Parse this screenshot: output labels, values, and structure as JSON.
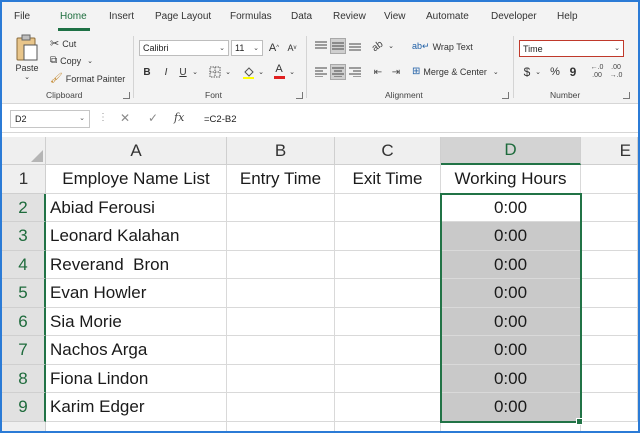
{
  "menu": {
    "items": [
      "File",
      "Home",
      "Insert",
      "Page Layout",
      "Formulas",
      "Data",
      "Review",
      "View",
      "Automate",
      "Developer",
      "Help"
    ],
    "active": "Home"
  },
  "clipboard": {
    "paste": "Paste",
    "cut": "Cut",
    "copy": "Copy",
    "format_painter": "Format Painter",
    "group_label": "Clipboard"
  },
  "font": {
    "name": "Calibri",
    "size": "11",
    "grow": "A",
    "shrink": "A",
    "bold": "B",
    "italic": "I",
    "underline": "U",
    "color_letter": "A",
    "group_label": "Font"
  },
  "alignment": {
    "wrap_text": "Wrap Text",
    "merge_center": "Merge & Center",
    "group_label": "Alignment"
  },
  "number": {
    "format": "Time",
    "currency": "$",
    "percent": "%",
    "comma": "9",
    "group_label": "Number"
  },
  "formula_bar": {
    "name_box": "D2",
    "cancel": "✕",
    "enter": "✓",
    "fx": "fx",
    "formula": "=C2-B2"
  },
  "sheet": {
    "columns": [
      "A",
      "B",
      "C",
      "D",
      "E"
    ],
    "headers": [
      "Employe Name List",
      "Entry Time",
      "Exit Time",
      "Working Hours"
    ],
    "rows": [
      {
        "num": "1"
      },
      {
        "num": "2",
        "name": "Abiad Ferousi",
        "hours": "0:00"
      },
      {
        "num": "3",
        "name": "Leonard Kalahan",
        "hours": "0:00"
      },
      {
        "num": "4",
        "name": "Reverand  Bron",
        "hours": "0:00"
      },
      {
        "num": "5",
        "name": "Evan Howler",
        "hours": "0:00"
      },
      {
        "num": "6",
        "name": "Sia Morie",
        "hours": "0:00"
      },
      {
        "num": "7",
        "name": "Nachos Arga",
        "hours": "0:00"
      },
      {
        "num": "8",
        "name": "Fiona Lindon",
        "hours": "0:00"
      },
      {
        "num": "9",
        "name": "Karim Edger",
        "hours": "0:00"
      }
    ]
  },
  "colors": {
    "accent": "#217346",
    "frame": "#2b7bd6",
    "number_format_border": "#c0392b",
    "font_color_bar": "#e02020"
  }
}
